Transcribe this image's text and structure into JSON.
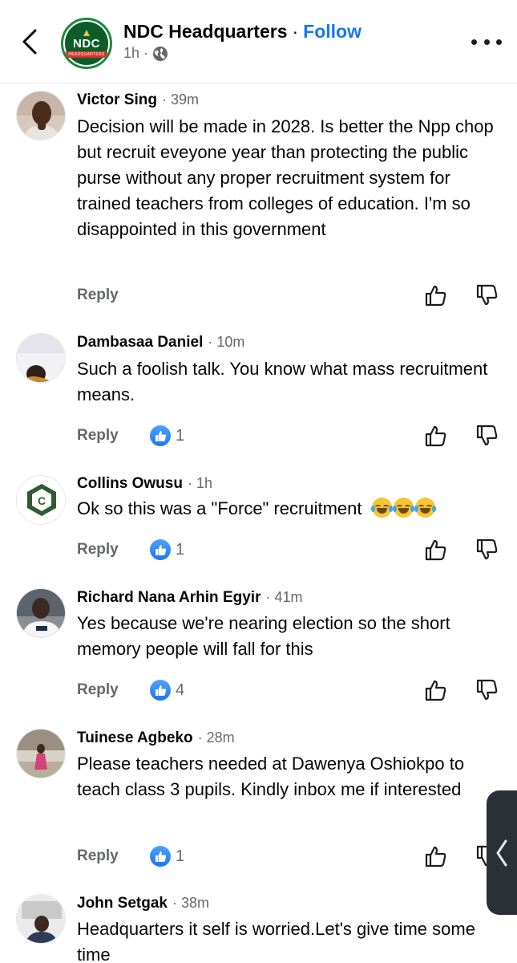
{
  "header": {
    "page_name": "NDC Headquarters",
    "separator": "·",
    "follow_label": "Follow",
    "post_time": "1h",
    "meta_dot": "·",
    "visibility_icon": "globe-icon",
    "logo_text": "NDC",
    "logo_subtext": "HEADQUARTERS",
    "brand_color": "#0c5d2a",
    "link_color": "#1877f2"
  },
  "labels": {
    "reply": "Reply"
  },
  "comments": [
    {
      "author": "Victor Sing",
      "time": "· 39m",
      "text": "Decision  will be made in 2028. Is better  the Npp chop but recruit eveyone  year than protecting  the public  purse without  any proper recruitment  system  for trained teachers from colleges of education. I'm  so disappointed  in this government",
      "likes": ""
    },
    {
      "author": "Dambasaa Daniel",
      "time": "· 10m",
      "text": "Such a foolish talk. You know what mass recruitment means.",
      "likes": "1"
    },
    {
      "author": "Collins Owusu",
      "time": "· 1h",
      "text": "Ok so this was a \"Force\" recruitment",
      "emoji": "face-with-tears-of-joy x3",
      "likes": "1"
    },
    {
      "author": "Richard Nana Arhin Egyir",
      "time": "· 41m",
      "text": "Yes because we're nearing election so the short memory people will fall for this",
      "likes": "4"
    },
    {
      "author": "Tuinese Agbeko",
      "time": "· 28m",
      "text": "Please teachers needed at Dawenya Oshiokpo to teach class 3 pupils. Kindly inbox me if interested",
      "likes": "1"
    },
    {
      "author": "John Setgak",
      "time": "· 38m",
      "text": "Headquarters it self is worried.Let's give time some time",
      "likes": ""
    }
  ]
}
